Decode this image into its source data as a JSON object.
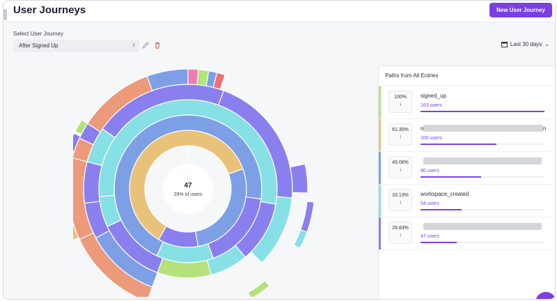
{
  "header": {
    "title": "User Journeys",
    "new_button_label": "New User Journey"
  },
  "selector": {
    "label": "Select User Journey",
    "value": "After Signed Up"
  },
  "date_range": {
    "label": "Last 30 days"
  },
  "sunburst": {
    "center_value": "47",
    "center_caption": "29% of users",
    "colors": {
      "green": "#b4e27c",
      "orange": "#e9c27a",
      "blue": "#7d9fe6",
      "cyan": "#86e0e6",
      "purple": "#8a7fee",
      "salmon": "#ec9a7a",
      "pink": "#ef7db5",
      "red": "#ee6f78"
    }
  },
  "paths_panel": {
    "title": "Paths from All Entries",
    "rows": [
      {
        "pct": "100%",
        "name": "signed_up",
        "users": "163 users",
        "fraction": 1.0,
        "color": "#b4e27c",
        "redacted": false
      },
      {
        "pct": "61.35%",
        "name": "n",
        "suffix": "n",
        "users": "100 users",
        "fraction": 0.61,
        "color": "#e9c27a",
        "redacted": true
      },
      {
        "pct": "49.08%",
        "name": "",
        "users": "80 users",
        "fraction": 0.49,
        "color": "#7d9fe6",
        "redacted": true
      },
      {
        "pct": "33.13%",
        "name": "workspace_created",
        "users": "54 users",
        "fraction": 0.33,
        "color": "#86e0e6",
        "redacted": false
      },
      {
        "pct": "28.83%",
        "name": "",
        "users": "47 users",
        "fraction": 0.29,
        "color": "#8a7fee",
        "redacted": true
      }
    ]
  }
}
